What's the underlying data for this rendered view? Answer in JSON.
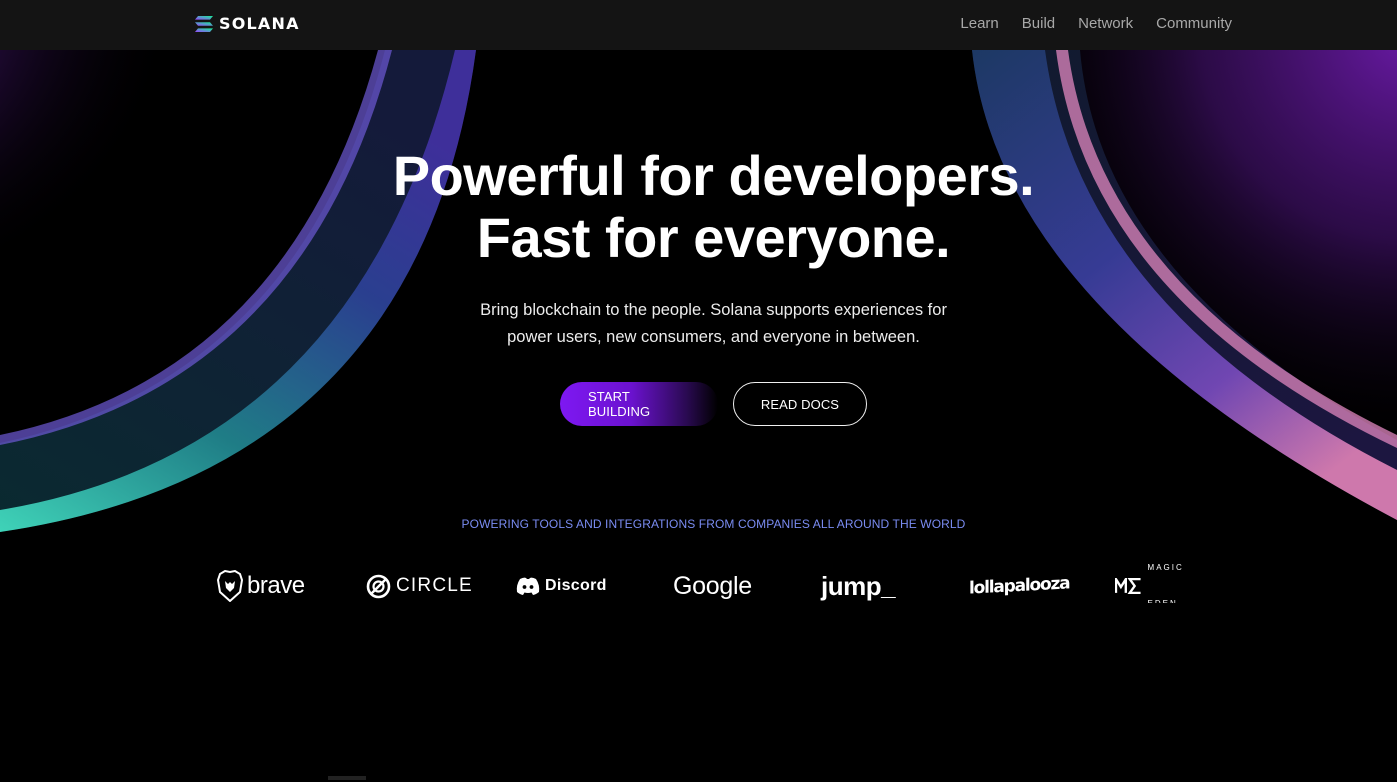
{
  "header": {
    "brand": "SOLANA",
    "nav": [
      "Learn",
      "Build",
      "Network",
      "Community"
    ]
  },
  "hero": {
    "title_line1": "Powerful for developers.",
    "title_line2": "Fast for everyone.",
    "subtitle_line1": "Bring blockchain to the people. Solana supports experiences for",
    "subtitle_line2": "power users, new consumers, and everyone in between.",
    "primary_button": "START BUILDING",
    "secondary_button": "READ DOCS"
  },
  "partners": {
    "label": "POWERING TOOLS AND INTEGRATIONS FROM COMPANIES ALL AROUND THE WORLD",
    "logos": [
      "brave",
      "CIRCLE",
      "Discord",
      "Google",
      "jump_",
      "lollapalooza",
      "MAGIC EDEN"
    ]
  },
  "colors": {
    "accent_purple": "#7e18f2",
    "partners_label": "#7a8cf2",
    "header_bg": "#141414"
  }
}
